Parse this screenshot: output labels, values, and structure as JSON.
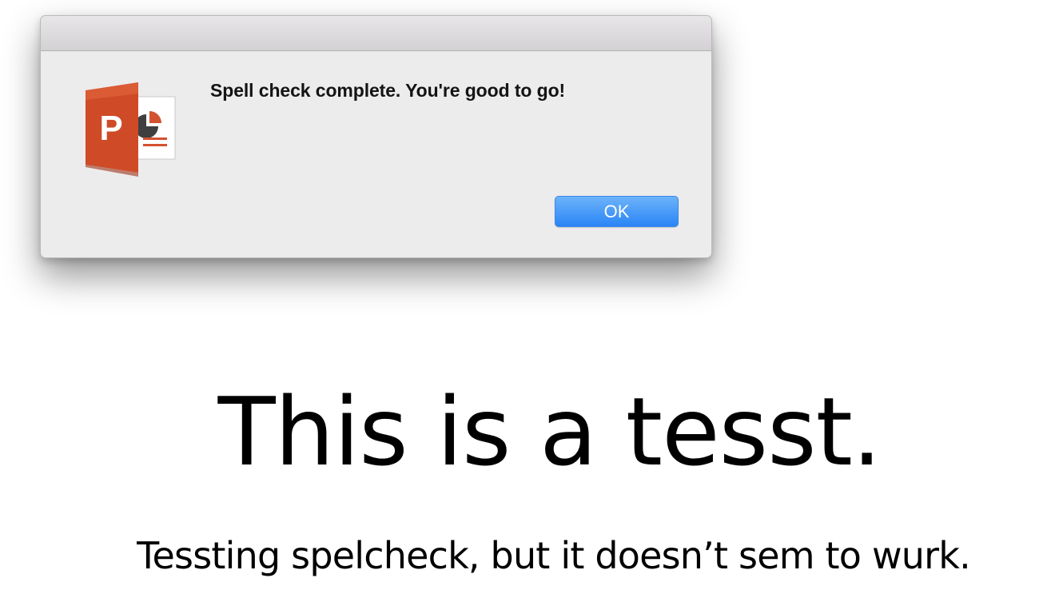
{
  "dialog": {
    "app_icon": "powerpoint-icon",
    "app_icon_letter": "P",
    "message": "Spell check complete. You're good to go!",
    "ok_label": "OK"
  },
  "slide": {
    "title": "This is a tesst.",
    "subtitle": "Tessting spelcheck, but it doesn’t sem to wurk."
  },
  "colors": {
    "button_accent": "#2a85f6",
    "powerpoint_brand": "#d04a28",
    "dialog_background": "#ececec"
  }
}
